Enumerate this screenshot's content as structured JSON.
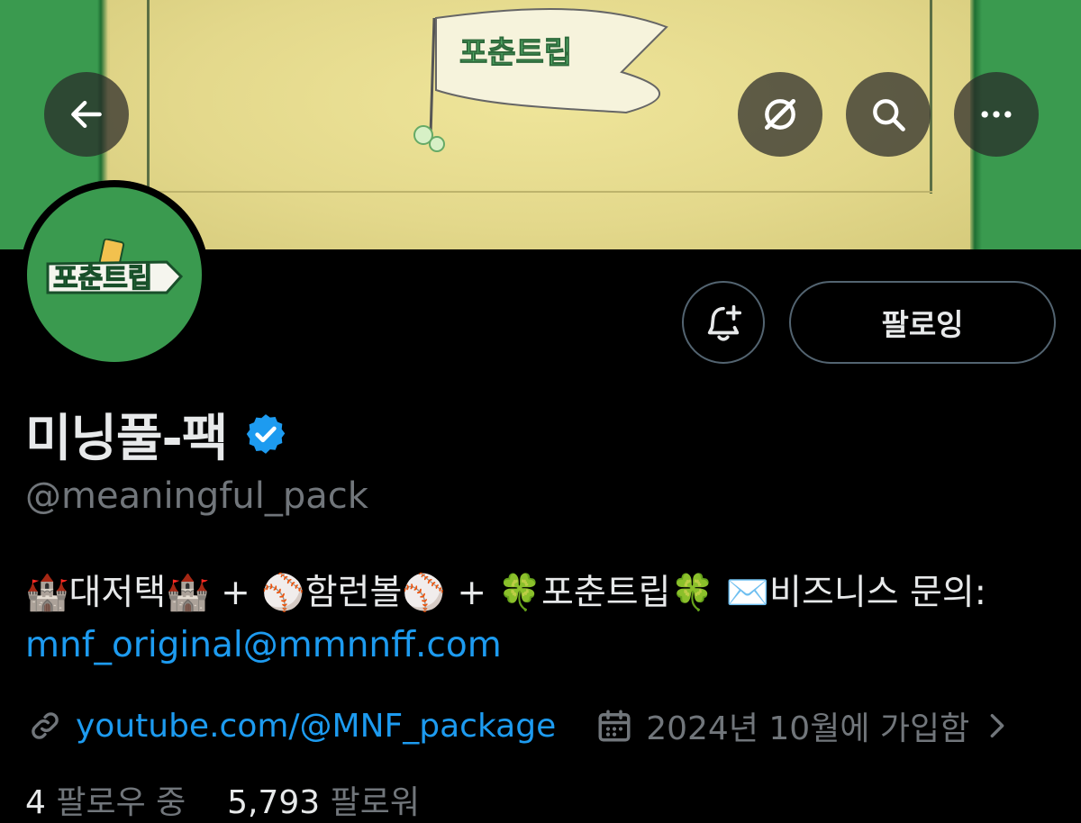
{
  "nav": {
    "back_icon": "arrow-left-icon",
    "grok_icon": "grok-slash-icon",
    "search_icon": "search-icon",
    "more_icon": "more-horizontal-icon"
  },
  "banner": {
    "artwork_lettering": "포춘트립",
    "colors": {
      "outer": "#3a9a4f",
      "paper": "#e6dc8e"
    }
  },
  "avatar": {
    "logo_text": "포춘트립",
    "background": "#3a9a4f"
  },
  "actions": {
    "notify_icon": "bell-plus-icon",
    "follow_label": "팔로잉"
  },
  "profile": {
    "display_name": "미닝풀-팩",
    "verified_icon": "verified-badge-icon",
    "verified_color": "#1d9bf0",
    "handle": "@meaningful_pack"
  },
  "bio": {
    "part1": "🏰대저택🏰 + ⚾함런볼⚾ + 🍀포춘트립🍀 ✉️비즈니스 문의: ",
    "email": "mnf_original@mmnnff.com"
  },
  "meta": {
    "link_icon": "link-icon",
    "website": "youtube.com/@MNF_package",
    "calendar_icon": "calendar-icon",
    "joined": "2024년 10월에 가입함",
    "chevron_icon": "chevron-right-icon"
  },
  "stats": {
    "following_count": "4",
    "following_label": "팔로우 중",
    "followers_count": "5,793",
    "followers_label": "팔로워"
  },
  "theme": {
    "background": "#000000",
    "text": "#e7e9ea",
    "muted": "#71767b",
    "link": "#1d9bf0",
    "border": "#536471"
  }
}
